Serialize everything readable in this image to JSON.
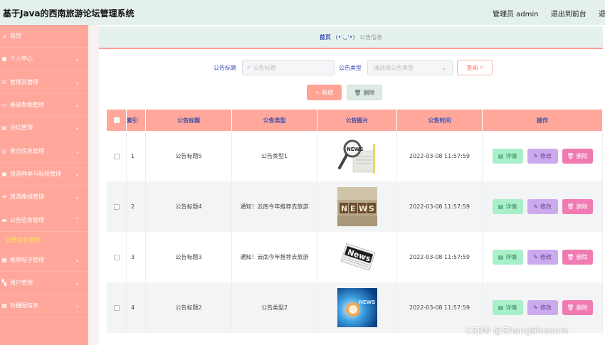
{
  "header": {
    "title": "基于Java的西南旅游论坛管理系统",
    "user": "管理员 admin",
    "to_front": "退出到前台",
    "logout": "退出登录"
  },
  "sidebar": {
    "items": [
      {
        "label": "首页",
        "icon": "home-icon",
        "arrow": false
      },
      {
        "label": "个人中心",
        "icon": "user-icon",
        "arrow": true
      },
      {
        "label": "管理员管理",
        "icon": "admin-icon",
        "arrow": true
      },
      {
        "label": "基础数据管理",
        "icon": "data-icon",
        "arrow": true
      },
      {
        "label": "论坛管理",
        "icon": "forum-icon",
        "arrow": true
      },
      {
        "label": "景点信息管理",
        "icon": "spot-icon",
        "arrow": true
      },
      {
        "label": "旅游种类与板块管理",
        "icon": "category-icon",
        "arrow": true
      },
      {
        "label": "旅游路线管理",
        "icon": "route-icon",
        "arrow": true
      },
      {
        "label": "公告信息管理",
        "icon": "notice-icon",
        "arrow": true
      }
    ],
    "submenu_active": "公告信息管理",
    "items_after": [
      {
        "label": "推荐帖子管理",
        "icon": "post-icon",
        "arrow": true
      },
      {
        "label": "用户管理",
        "icon": "users-icon",
        "arrow": true
      },
      {
        "label": "轮播图信息",
        "icon": "carousel-icon",
        "arrow": true
      }
    ]
  },
  "breadcrumb": {
    "home": "首页",
    "face": "(•'◡'•)",
    "current": "公告信息"
  },
  "search": {
    "title_label": "公告标题",
    "title_placeholder": "公告标题",
    "type_label": "公告类型",
    "type_placeholder": "请选择公告类型",
    "query_button": "查询"
  },
  "actions": {
    "add": "+ 新增",
    "delete": "删除"
  },
  "table": {
    "headers": {
      "index": "索引",
      "title": "公告标题",
      "type": "公告类型",
      "image": "公告图片",
      "time": "公告时间",
      "ops": "操作"
    },
    "rows": [
      {
        "index": "1",
        "title": "公告标题5",
        "type": "公告类型1",
        "image": "news-magnifier-image",
        "time": "2022-03-08 11:57:59"
      },
      {
        "index": "2",
        "title": "公告标题4",
        "type": "通知！云南今年推荐去旅游",
        "image": "news-blocks-image",
        "time": "2022-03-08 11:57:59"
      },
      {
        "index": "3",
        "title": "公告标题3",
        "type": "通知！云南今年推荐去旅游",
        "image": "news-paper-image",
        "time": "2022-03-08 11:57:59"
      },
      {
        "index": "4",
        "title": "公告标题2",
        "type": "公告类型2",
        "image": "news-blue-image",
        "time": "2022-03-08 11:57:59"
      }
    ],
    "op_detail": "详情",
    "op_edit": "修改",
    "op_delete": "删除"
  },
  "watermark": "CSDN @ZhangBlossom",
  "colors": {
    "sidebar": "#ffa79b",
    "header_bg": "#e4f0ec",
    "accent_blue": "#3d52b3",
    "detail_btn": "#a9efc9",
    "edit_btn": "#ccaaee",
    "delete_btn": "#f07ab1"
  }
}
